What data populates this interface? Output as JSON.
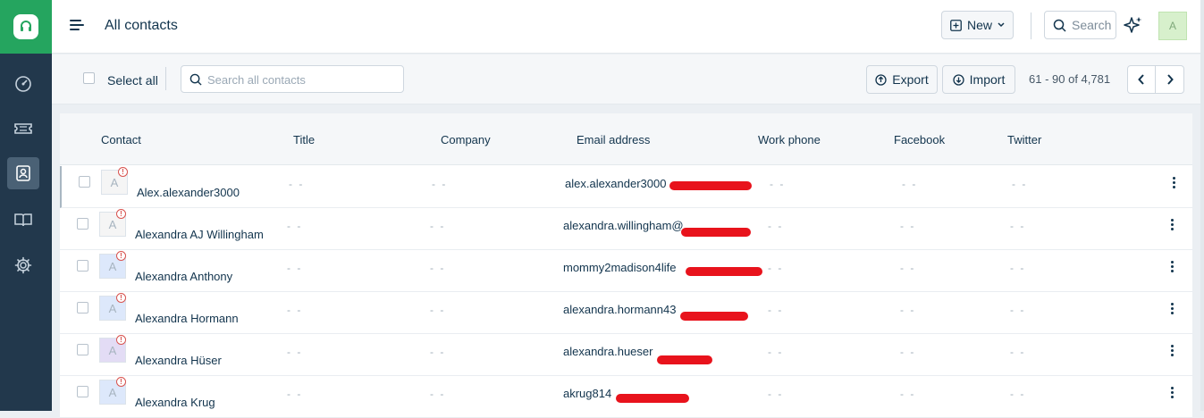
{
  "header": {
    "title": "All contacts",
    "new_label": "New",
    "search_label": "Search",
    "avatar_initial": "A"
  },
  "toolbar": {
    "select_all_label": "Select all",
    "search_placeholder": "Search all contacts",
    "export_label": "Export",
    "import_label": "Import",
    "pagination": "61 - 90 of 4,781"
  },
  "table": {
    "columns": [
      "Contact",
      "Title",
      "Company",
      "Email address",
      "Work phone",
      "Facebook",
      "Twitter"
    ],
    "empty_value": "- -",
    "rows": [
      {
        "initial": "A",
        "name": "Alex.alexander3000",
        "email": "alex.alexander3000",
        "avatar_bg": "#f5f5f5"
      },
      {
        "initial": "A",
        "name": "Alexandra AJ Willingham",
        "email": "alexandra.willingham@",
        "avatar_bg": "#f5f5f5"
      },
      {
        "initial": "A",
        "name": "Alexandra Anthony",
        "email": "mommy2madison4life",
        "avatar_bg": "#dde8fb"
      },
      {
        "initial": "A",
        "name": "Alexandra Hormann",
        "email": "alexandra.hormann43",
        "avatar_bg": "#dde8fb"
      },
      {
        "initial": "A",
        "name": "Alexandra Hüser",
        "email": "alexandra.hueser",
        "avatar_bg": "#e3dcf5"
      },
      {
        "initial": "A",
        "name": "Alexandra Krug",
        "email": "akrug814",
        "avatar_bg": "#dde8fb"
      }
    ]
  },
  "colors": {
    "sidebar": "#22384c",
    "brand": "#25a55f",
    "redaction": "#e8131c"
  }
}
